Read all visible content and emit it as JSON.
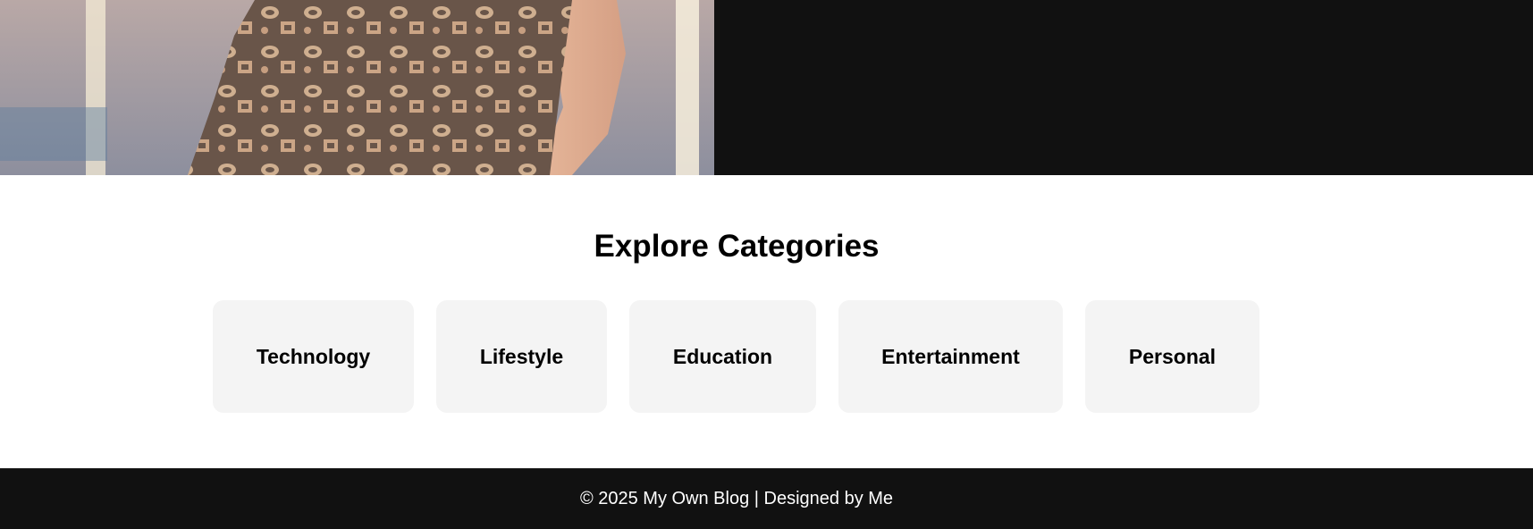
{
  "hero": {
    "image_alt": "Person wearing a brown paisley-patterned outfit"
  },
  "categories": {
    "title": "Explore Categories",
    "items": [
      {
        "label": "Technology"
      },
      {
        "label": "Lifestyle"
      },
      {
        "label": "Education"
      },
      {
        "label": "Entertainment"
      },
      {
        "label": "Personal"
      }
    ]
  },
  "footer": {
    "text": "© 2025 My Own Blog | Designed by Me"
  },
  "colors": {
    "dark_band": "#111111",
    "card_bg": "#f4f4f4",
    "text": "#000000",
    "footer_text": "#ffffff"
  }
}
